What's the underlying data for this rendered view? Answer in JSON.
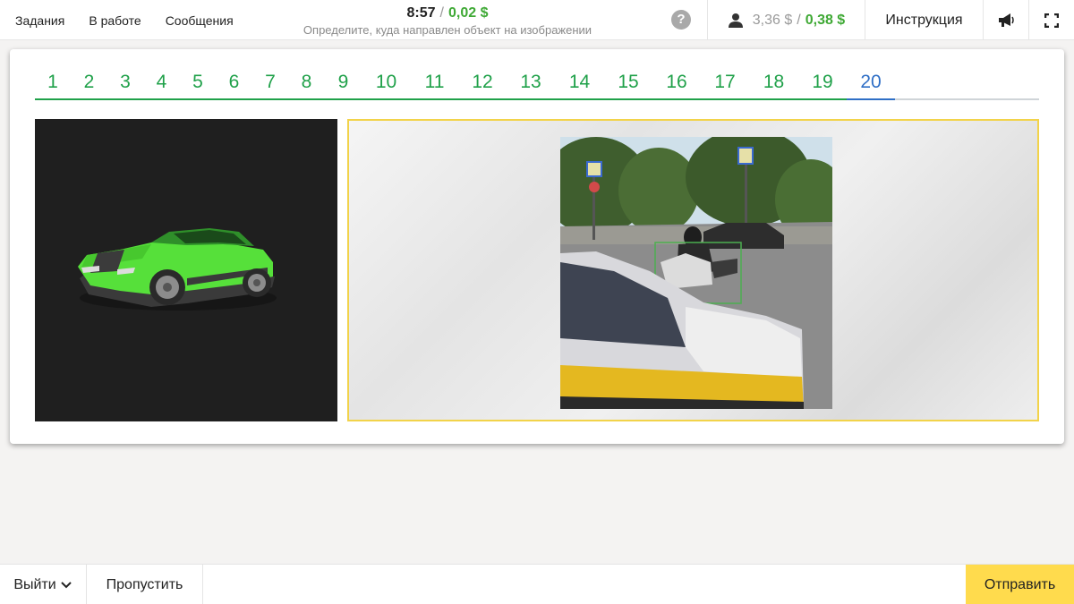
{
  "header": {
    "nav": [
      "Задания",
      "В работе",
      "Сообщения"
    ],
    "timer": "8:57",
    "separator": "/",
    "reward": "0,02 $",
    "subtitle": "Определите, куда направлен объект на изображении",
    "help_label": "?",
    "balance_total": "3,36 $",
    "balance_sep": "/",
    "balance_today": "0,38 $",
    "instructions_label": "Инструкция",
    "icons": [
      "help-icon",
      "user-balance-icon",
      "megaphone-icon",
      "fullscreen-icon"
    ]
  },
  "tabs": {
    "items": [
      "1",
      "2",
      "3",
      "4",
      "5",
      "6",
      "7",
      "8",
      "9",
      "10",
      "11",
      "12",
      "13",
      "14",
      "15",
      "16",
      "17",
      "18",
      "19",
      "20"
    ],
    "active": "20"
  },
  "images": {
    "reference": "green-car-3d-model",
    "task": "street-photo-motorcycle-bounding-box"
  },
  "footer": {
    "exit_label": "Выйти",
    "skip_label": "Пропустить",
    "submit_label": "Отправить"
  },
  "colors": {
    "accent_green": "#20a14a",
    "active_blue": "#2f6fc6",
    "submit_yellow": "#ffdb4d",
    "frame_yellow": "#f2d34a",
    "bbox_green": "#4caf50"
  }
}
